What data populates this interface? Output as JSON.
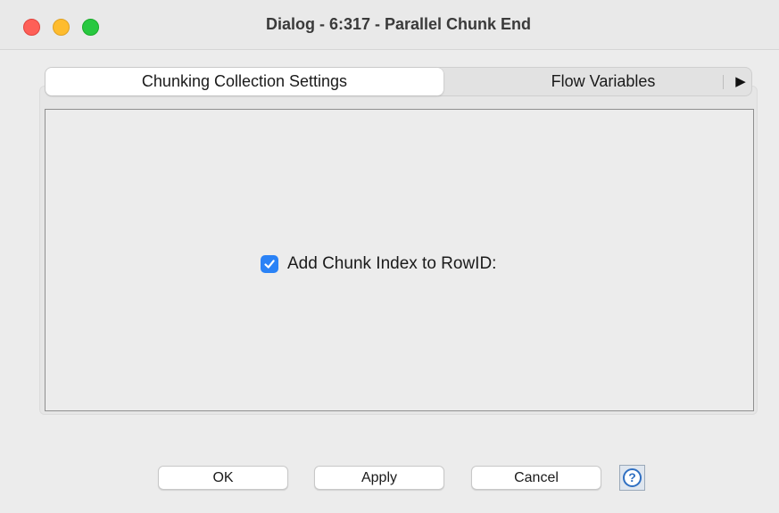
{
  "window": {
    "title": "Dialog - 6:317 - Parallel Chunk End"
  },
  "tabs": [
    {
      "label": "Chunking Collection Settings",
      "active": true
    },
    {
      "label": "Flow Variables",
      "active": false
    }
  ],
  "tab_overflow_icon": "▶",
  "settings": {
    "add_chunk_index": {
      "label": "Add Chunk Index to RowID:",
      "checked": true
    }
  },
  "buttons": {
    "ok": "OK",
    "apply": "Apply",
    "cancel": "Cancel",
    "help": "?"
  },
  "colors": {
    "accent": "#2a82f6",
    "close": "#fe5f57",
    "minimize": "#febc2e",
    "zoom": "#28c840"
  },
  "icons": {
    "close": "close-traffic-light-icon",
    "minimize": "minimize-traffic-light-icon",
    "zoom": "zoom-traffic-light-icon",
    "tab_overflow": "triangle-right-icon",
    "checkbox": "checkmark-icon",
    "help": "help-circle-icon"
  }
}
